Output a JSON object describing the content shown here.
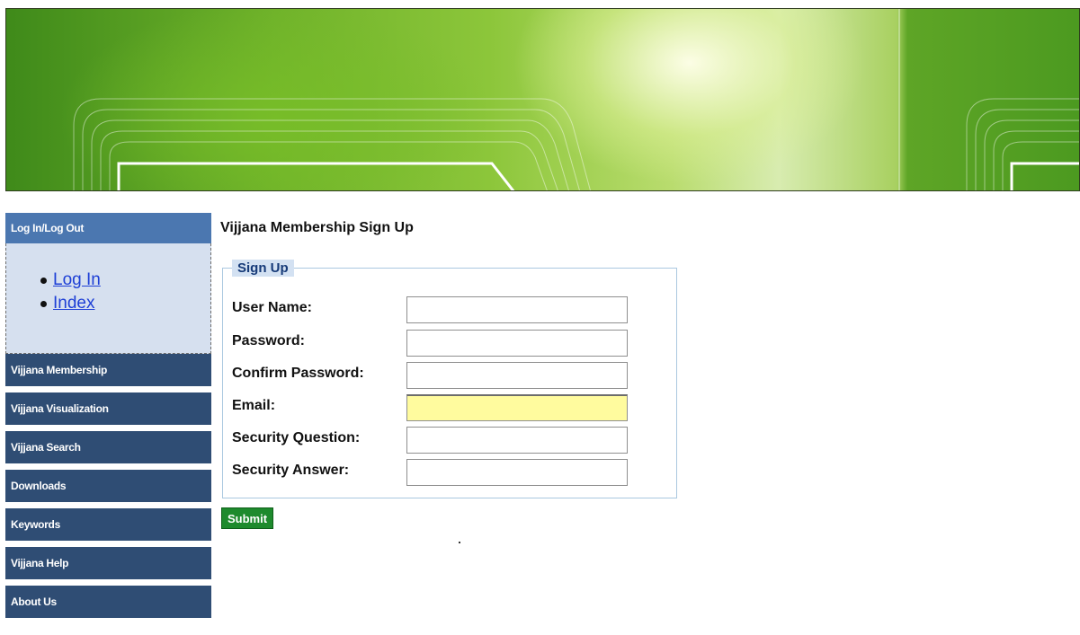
{
  "sidebar": {
    "header": "Log In/Log Out",
    "login_links": [
      {
        "label": "Log In"
      },
      {
        "label": "Index"
      }
    ],
    "nav_items": [
      {
        "label": "Vijjana Membership"
      },
      {
        "label": "Vijjana Visualization"
      },
      {
        "label": "Vijjana Search"
      },
      {
        "label": "Downloads"
      },
      {
        "label": "Keywords"
      },
      {
        "label": "Vijjana Help"
      },
      {
        "label": "About Us"
      }
    ]
  },
  "main": {
    "title": "Vijjana Membership Sign Up",
    "form": {
      "legend": "Sign Up",
      "fields": [
        {
          "label": "User Name:",
          "value": ""
        },
        {
          "label": "Password:",
          "value": ""
        },
        {
          "label": "Confirm Password:",
          "value": ""
        },
        {
          "label": "Email:",
          "value": ""
        },
        {
          "label": "Security Question:",
          "value": ""
        },
        {
          "label": "Security Answer:",
          "value": ""
        }
      ],
      "submit_label": "Submit"
    }
  },
  "colors": {
    "sidebar_header": "#4b77b0",
    "nav_item": "#2f4d74",
    "login_box": "#d6e0ef",
    "submit_button": "#1e8a2d",
    "email_highlight": "#fffb9e"
  }
}
